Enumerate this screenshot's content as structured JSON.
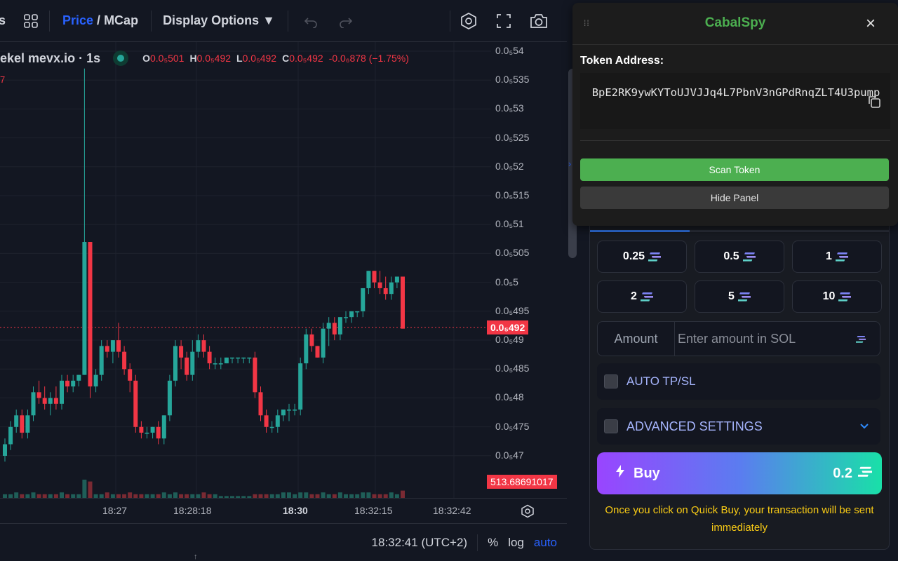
{
  "toolbar": {
    "price_label": "Price",
    "slash": " / ",
    "mcap_label": "MCap",
    "display_options": "Display Options ▼"
  },
  "legend": {
    "symbol": "ekel mevx.io · 1s",
    "o_label": "O",
    "o_value": "0.0₅501",
    "h_label": "H",
    "h_value": "0.0₅492",
    "l_label": "L",
    "l_value": "0.0₅492",
    "c_label": "C",
    "c_value": "0.0₅492",
    "change": "-0.0₆878 (−1.75%)",
    "sub": "7"
  },
  "price_axis": {
    "ticks": [
      "0.0₅54",
      "0.0₅535",
      "0.0₅53",
      "0.0₅525",
      "0.0₅52",
      "0.0₅515",
      "0.0₅51",
      "0.0₅505",
      "0.0₅5",
      "0.0₅495",
      "0.0₅49",
      "0.0₅485",
      "0.0₅48",
      "0.0₅475",
      "0.0₅47"
    ],
    "current_price": "0.0₅492",
    "volume_tag": "513.68691017"
  },
  "time_axis": {
    "ticks": [
      "18:27",
      "18:28:18",
      "18:30",
      "18:32:15",
      "18:32:42"
    ]
  },
  "statusbar": {
    "time": "18:32:41 (UTC+2)",
    "percent": "%",
    "log": "log",
    "auto": "auto"
  },
  "cabalspy": {
    "title": "CabalSpy",
    "close": "×",
    "token_label": "Token Address:",
    "token_address": "BpE2RK9ywKYToUJVJJq4L7PbnV3nGPdRnqZLT4U3pump",
    "scan_button": "Scan Token",
    "hide_button": "Hide Panel"
  },
  "trade": {
    "quick_amounts": [
      "0.25",
      "0.5",
      "1",
      "2",
      "5",
      "10"
    ],
    "amount_label": "Amount",
    "amount_placeholder": "Enter amount in SOL",
    "auto_tpsl": "AUTO TP/SL",
    "advanced": "ADVANCED SETTINGS",
    "buy_label": "Buy",
    "buy_amount": "0.2",
    "note": "Once you click on Quick Buy, your transaction will be sent immediately"
  },
  "colors": {
    "up": "#26a69a",
    "down": "#f23645",
    "accent": "#2962ff",
    "cabal_green": "#4caf50",
    "note_yellow": "#facc15"
  },
  "chart_data": {
    "type": "candlestick",
    "ylim": [
      4.65e-07,
      5.43e-07
    ],
    "price_unit": "1e-5 scaled (0.0₅ notation)",
    "current": 4.92e-06,
    "candles_ohlc": [
      [
        4.7e-06,
        4.73e-06,
        4.69e-06,
        4.72e-06
      ],
      [
        4.72e-06,
        4.76e-06,
        4.71e-06,
        4.75e-06
      ],
      [
        4.75e-06,
        4.78e-06,
        4.74e-06,
        4.77e-06
      ],
      [
        4.77e-06,
        4.78e-06,
        4.73e-06,
        4.74e-06
      ],
      [
        4.74e-06,
        4.78e-06,
        4.73e-06,
        4.77e-06
      ],
      [
        4.77e-06,
        4.82e-06,
        4.76e-06,
        4.81e-06
      ],
      [
        4.81e-06,
        4.83e-06,
        4.79e-06,
        4.8e-06
      ],
      [
        4.8e-06,
        4.82e-06,
        4.78e-06,
        4.79e-06
      ],
      [
        4.79e-06,
        4.81e-06,
        4.77e-06,
        4.8e-06
      ],
      [
        4.8e-06,
        4.82e-06,
        4.78e-06,
        4.79e-06
      ],
      [
        4.79e-06,
        4.84e-06,
        4.78e-06,
        4.83e-06
      ],
      [
        4.83e-06,
        4.84e-06,
        4.81e-06,
        4.82e-06
      ],
      [
        4.82e-06,
        4.84e-06,
        4.81e-06,
        4.83e-06
      ],
      [
        4.83e-06,
        4.84e-06,
        4.82e-06,
        4.84e-06
      ],
      [
        4.84e-06,
        5.37e-06,
        4.84e-06,
        5.07e-06
      ],
      [
        5.07e-06,
        5.07e-06,
        4.8e-06,
        4.82e-06
      ],
      [
        4.82e-06,
        4.85e-06,
        4.81e-06,
        4.84e-06
      ],
      [
        4.84e-06,
        4.9e-06,
        4.83e-06,
        4.89e-06
      ],
      [
        4.89e-06,
        4.9e-06,
        4.87e-06,
        4.88e-06
      ],
      [
        4.88e-06,
        4.9e-06,
        4.86e-06,
        4.9e-06
      ],
      [
        4.9e-06,
        4.93e-06,
        4.87e-06,
        4.88e-06
      ],
      [
        4.88e-06,
        4.89e-06,
        4.84e-06,
        4.85e-06
      ],
      [
        4.85e-06,
        4.86e-06,
        4.81e-06,
        4.83e-06
      ],
      [
        4.83e-06,
        4.84e-06,
        4.74e-06,
        4.75e-06
      ],
      [
        4.75e-06,
        4.76e-06,
        4.73e-06,
        4.74e-06
      ],
      [
        4.74e-06,
        4.75e-06,
        4.73e-06,
        4.74e-06
      ],
      [
        4.74e-06,
        4.75e-06,
        4.73e-06,
        4.75e-06
      ],
      [
        4.75e-06,
        4.76e-06,
        4.72e-06,
        4.73e-06
      ],
      [
        4.73e-06,
        4.77e-06,
        4.72e-06,
        4.77e-06
      ],
      [
        4.77e-06,
        4.84e-06,
        4.76e-06,
        4.83e-06
      ],
      [
        4.83e-06,
        4.9e-06,
        4.82e-06,
        4.89e-06
      ],
      [
        4.89e-06,
        4.9e-06,
        4.85e-06,
        4.87e-06
      ],
      [
        4.87e-06,
        4.88e-06,
        4.83e-06,
        4.84e-06
      ],
      [
        4.84e-06,
        4.9e-06,
        4.83e-06,
        4.88e-06
      ],
      [
        4.88e-06,
        4.91e-06,
        4.87e-06,
        4.9e-06
      ],
      [
        4.9e-06,
        4.91e-06,
        4.87e-06,
        4.88e-06
      ],
      [
        4.88e-06,
        4.89e-06,
        4.85e-06,
        4.86e-06
      ],
      [
        4.86e-06,
        4.87e-06,
        4.85e-06,
        4.86e-06
      ],
      [
        4.86e-06,
        4.87e-06,
        4.85e-06,
        4.86e-06
      ],
      [
        4.86e-06,
        4.87e-06,
        4.86e-06,
        4.87e-06
      ],
      [
        4.87e-06,
        4.87e-06,
        4.86e-06,
        4.87e-06
      ],
      [
        4.87e-06,
        4.87e-06,
        4.86e-06,
        4.87e-06
      ],
      [
        4.87e-06,
        4.87e-06,
        4.86e-06,
        4.87e-06
      ],
      [
        4.87e-06,
        4.87e-06,
        4.86e-06,
        4.87e-06
      ],
      [
        4.87e-06,
        4.88e-06,
        4.8e-06,
        4.81e-06
      ],
      [
        4.81e-06,
        4.82e-06,
        4.76e-06,
        4.77e-06
      ],
      [
        4.77e-06,
        4.78e-06,
        4.74e-06,
        4.75e-06
      ],
      [
        4.75e-06,
        4.76e-06,
        4.74e-06,
        4.75e-06
      ],
      [
        4.75e-06,
        4.78e-06,
        4.74e-06,
        4.77e-06
      ],
      [
        4.77e-06,
        4.78e-06,
        4.76e-06,
        4.78e-06
      ],
      [
        4.78e-06,
        4.79e-06,
        4.76e-06,
        4.78e-06
      ],
      [
        4.78e-06,
        4.79e-06,
        4.77e-06,
        4.78e-06
      ],
      [
        4.78e-06,
        4.87e-06,
        4.77e-06,
        4.86e-06
      ],
      [
        4.86e-06,
        4.92e-06,
        4.85e-06,
        4.91e-06
      ],
      [
        4.91e-06,
        4.92e-06,
        4.88e-06,
        4.89e-06
      ],
      [
        4.89e-06,
        4.89e-06,
        4.87e-06,
        4.87e-06
      ],
      [
        4.87e-06,
        4.93e-06,
        4.86e-06,
        4.92e-06
      ],
      [
        4.92e-06,
        4.94e-06,
        4.89e-06,
        4.93e-06
      ],
      [
        4.93e-06,
        4.94e-06,
        4.9e-06,
        4.91e-06
      ],
      [
        4.91e-06,
        4.94e-06,
        4.9e-06,
        4.94e-06
      ],
      [
        4.94e-06,
        4.95e-06,
        4.93e-06,
        4.94e-06
      ],
      [
        4.94e-06,
        4.95e-06,
        4.93e-06,
        4.95e-06
      ],
      [
        4.95e-06,
        4.95e-06,
        4.94e-06,
        4.95e-06
      ],
      [
        4.95e-06,
        4.99e-06,
        4.94e-06,
        4.99e-06
      ],
      [
        4.99e-06,
        5.02e-06,
        4.98e-06,
        5.02e-06
      ],
      [
        5.02e-06,
        5.02e-06,
        4.99e-06,
        5e-06
      ],
      [
        5e-06,
        5.02e-06,
        4.98e-06,
        4.99e-06
      ],
      [
        4.99e-06,
        5.01e-06,
        4.97e-06,
        4.98e-06
      ],
      [
        4.98e-06,
        5.01e-06,
        4.97e-06,
        5e-06
      ],
      [
        5e-06,
        5.01e-06,
        4.99e-06,
        5.01e-06
      ],
      [
        5.01e-06,
        5.01e-06,
        4.92e-06,
        4.92e-06
      ]
    ],
    "volumes": [
      2,
      2,
      3,
      2,
      2,
      3,
      2,
      2,
      2,
      2,
      3,
      2,
      2,
      2,
      10,
      9,
      2,
      2,
      3,
      2,
      2,
      2,
      3,
      2,
      2,
      2,
      2,
      2,
      3,
      2,
      3,
      2,
      2,
      2,
      2,
      3,
      2,
      2,
      1,
      1,
      1,
      1,
      1,
      1,
      2,
      2,
      2,
      2,
      2,
      3,
      3,
      2,
      3,
      3,
      2,
      2,
      3,
      2,
      2,
      3,
      2,
      2,
      2,
      3,
      3,
      2,
      2,
      2,
      3,
      2,
      4
    ]
  }
}
